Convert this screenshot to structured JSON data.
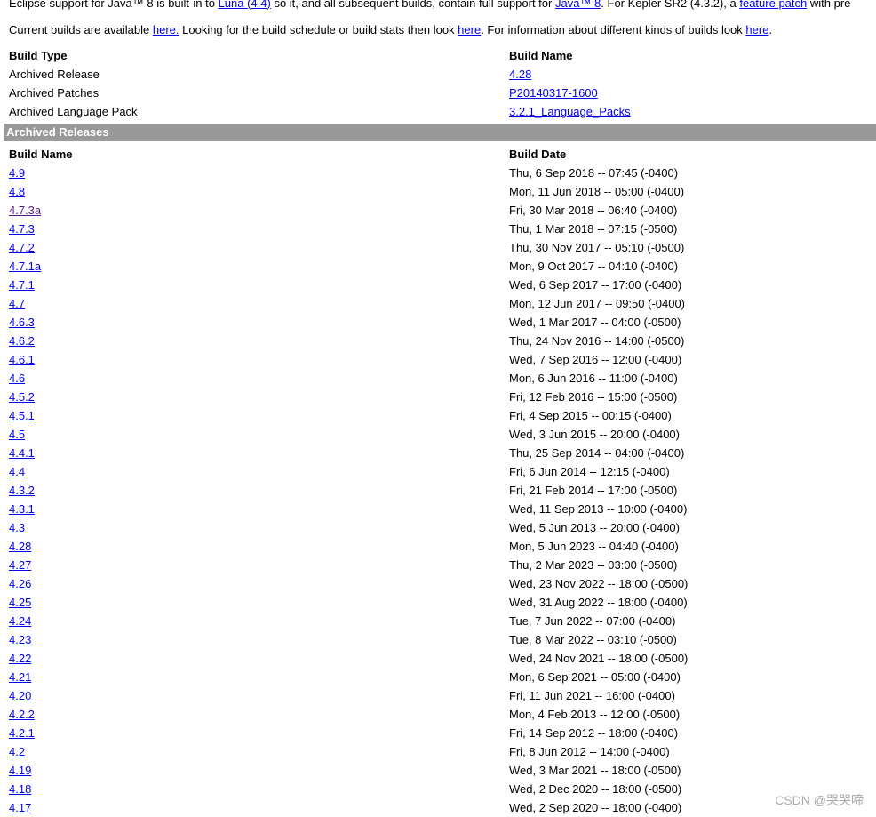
{
  "intro": {
    "line1": {
      "t1": "Eclipse support for Java™ 8 is built-in to ",
      "link1": "Luna (4.4)",
      "t2": " so it, and all subsequent builds, contain full support for ",
      "link2": "Java™ 8",
      "t3": ". For Kepler SR2 (4.3.2), a ",
      "link3": "feature patch",
      "t4": " with pre"
    },
    "line2": {
      "t1": "Current builds are available ",
      "link1": "here.",
      "t2": " Looking for the build schedule or build stats then look ",
      "link2": "here",
      "t3": ". For information about different kinds of builds look ",
      "link3": "here",
      "t4": "."
    }
  },
  "archive_table": {
    "headers": [
      "Build Type",
      "Build Name"
    ],
    "rows": [
      {
        "type": "Archived Release",
        "name": "4.28"
      },
      {
        "type": "Archived Patches",
        "name": "P20140317-1600"
      },
      {
        "type": "Archived Language Pack",
        "name": "3.2.1_Language_Packs"
      }
    ]
  },
  "releases": {
    "section_title": "Archived Releases",
    "headers": [
      "Build Name",
      "Build Date"
    ],
    "rows": [
      {
        "name": "4.9",
        "date": "Thu, 6 Sep 2018 -- 07:45 (-0400)"
      },
      {
        "name": "4.8",
        "date": "Mon, 11 Jun 2018 -- 05:00 (-0400)"
      },
      {
        "name": "4.7.3a",
        "date": "Fri, 30 Mar 2018 -- 06:40 (-0400)",
        "visited": true
      },
      {
        "name": "4.7.3",
        "date": "Thu, 1 Mar 2018 -- 07:15 (-0500)"
      },
      {
        "name": "4.7.2",
        "date": "Thu, 30 Nov 2017 -- 05:10 (-0500)"
      },
      {
        "name": "4.7.1a",
        "date": "Mon, 9 Oct 2017 -- 04:10 (-0400)"
      },
      {
        "name": "4.7.1",
        "date": "Wed, 6 Sep 2017 -- 17:00 (-0400)"
      },
      {
        "name": "4.7",
        "date": "Mon, 12 Jun 2017 -- 09:50 (-0400)"
      },
      {
        "name": "4.6.3",
        "date": "Wed, 1 Mar 2017 -- 04:00 (-0500)"
      },
      {
        "name": "4.6.2",
        "date": "Thu, 24 Nov 2016 -- 14:00 (-0500)"
      },
      {
        "name": "4.6.1",
        "date": "Wed, 7 Sep 2016 -- 12:00 (-0400)"
      },
      {
        "name": "4.6",
        "date": "Mon, 6 Jun 2016 -- 11:00 (-0400)"
      },
      {
        "name": "4.5.2",
        "date": "Fri, 12 Feb 2016 -- 15:00 (-0500)"
      },
      {
        "name": "4.5.1",
        "date": "Fri, 4 Sep 2015 -- 00:15 (-0400)"
      },
      {
        "name": "4.5",
        "date": "Wed, 3 Jun 2015 -- 20:00 (-0400)"
      },
      {
        "name": "4.4.1",
        "date": "Thu, 25 Sep 2014 -- 04:00 (-0400)"
      },
      {
        "name": "4.4",
        "date": "Fri, 6 Jun 2014 -- 12:15 (-0400)"
      },
      {
        "name": "4.3.2",
        "date": "Fri, 21 Feb 2014 -- 17:00 (-0500)"
      },
      {
        "name": "4.3.1",
        "date": "Wed, 11 Sep 2013 -- 10:00 (-0400)"
      },
      {
        "name": "4.3",
        "date": "Wed, 5 Jun 2013 -- 20:00 (-0400)"
      },
      {
        "name": "4.28",
        "date": "Mon, 5 Jun 2023 -- 04:40 (-0400)"
      },
      {
        "name": "4.27",
        "date": "Thu, 2 Mar 2023 -- 03:00 (-0500)"
      },
      {
        "name": "4.26",
        "date": "Wed, 23 Nov 2022 -- 18:00 (-0500)"
      },
      {
        "name": "4.25",
        "date": "Wed, 31 Aug 2022 -- 18:00 (-0400)"
      },
      {
        "name": "4.24",
        "date": "Tue, 7 Jun 2022 -- 07:00 (-0400)"
      },
      {
        "name": "4.23",
        "date": "Tue, 8 Mar 2022 -- 03:10 (-0500)"
      },
      {
        "name": "4.22",
        "date": "Wed, 24 Nov 2021 -- 18:00 (-0500)"
      },
      {
        "name": "4.21",
        "date": "Mon, 6 Sep 2021 -- 05:00 (-0400)"
      },
      {
        "name": "4.20",
        "date": "Fri, 11 Jun 2021 -- 16:00 (-0400)"
      },
      {
        "name": "4.2.2",
        "date": "Mon, 4 Feb 2013 -- 12:00 (-0500)"
      },
      {
        "name": "4.2.1",
        "date": "Fri, 14 Sep 2012 -- 18:00 (-0400)"
      },
      {
        "name": "4.2",
        "date": "Fri, 8 Jun 2012 -- 14:00 (-0400)"
      },
      {
        "name": "4.19",
        "date": "Wed, 3 Mar 2021 -- 18:00 (-0500)"
      },
      {
        "name": "4.18",
        "date": "Wed, 2 Dec 2020 -- 18:00 (-0500)"
      },
      {
        "name": "4.17",
        "date": "Wed, 2 Sep 2020 -- 18:00 (-0400)"
      }
    ]
  },
  "watermark": "CSDN @哭哭啼"
}
